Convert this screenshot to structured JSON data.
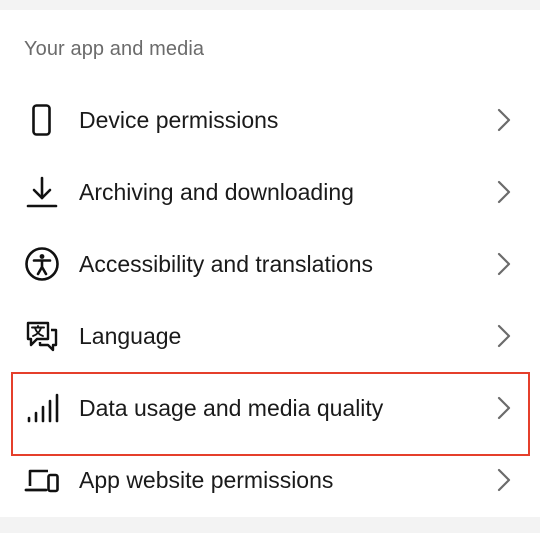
{
  "section": {
    "title": "Your app and media"
  },
  "items": [
    {
      "label": "Device permissions",
      "icon": "phone-icon"
    },
    {
      "label": "Archiving and downloading",
      "icon": "download-icon"
    },
    {
      "label": "Accessibility and translations",
      "icon": "accessibility-icon"
    },
    {
      "label": "Language",
      "icon": "language-icon"
    },
    {
      "label": "Data usage and media quality",
      "icon": "signal-bars-icon",
      "highlighted": true
    },
    {
      "label": "App website permissions",
      "icon": "devices-icon"
    }
  ],
  "colors": {
    "highlight": "#e53f2b",
    "text": "#1a1a1a",
    "section_title": "#6b6b6b",
    "chevron": "#6b6b6b"
  }
}
